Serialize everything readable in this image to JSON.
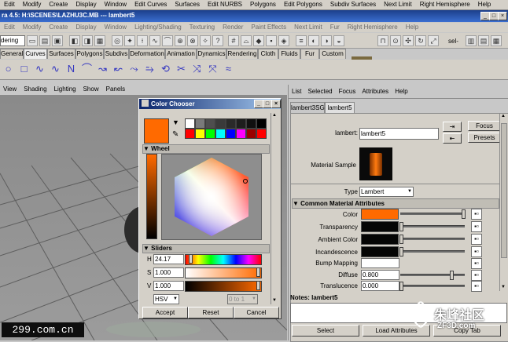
{
  "menubar": [
    "Edit",
    "Modify",
    "Create",
    "Display",
    "Window",
    "Edit Curves",
    "Surfaces",
    "Edit NURBS",
    "Polygons",
    "Edit Polygons",
    "Subdiv Surfaces",
    "Next Limit",
    "Right Hemisphere",
    "Help"
  ],
  "window_title": "ra 4.5: H:\\SCENES\\LAZHU3C.MB  ---  lambert5",
  "menubar2": [
    "Edit",
    "Modify",
    "Create",
    "Display",
    "Window",
    "Lighting/Shading",
    "Texturing",
    "Render",
    "Paint Effects",
    "Next Limit",
    "Fur",
    "Right Hemisphere",
    "Help"
  ],
  "mode_selector": "dering",
  "status_right": "sel-",
  "shelf_tabs": [
    "General",
    "Curves",
    "Surfaces",
    "Polygons",
    "Subdivs",
    "Deformation",
    "Animation",
    "Dynamics",
    "Rendering",
    "Cloth",
    "Fluids",
    "Fur",
    "Custom"
  ],
  "panel_menu": [
    "View",
    "Shading",
    "Lighting",
    "Show",
    "Panels"
  ],
  "color_chooser": {
    "title": "Color Chooser",
    "wheel_label": "Wheel",
    "sliders_label": "Sliders",
    "h_label": "H",
    "h_value": "24.17",
    "s_label": "S",
    "s_value": "1.000",
    "v_label": "V",
    "v_value": "1.000",
    "mode": "HSV",
    "range": "0 to 1",
    "accept": "Accept",
    "reset": "Reset",
    "cancel": "Cancel",
    "current_color": "#ff6a00",
    "swatches_row1": [
      "#ffffff",
      "#7a7a7a",
      "#4e4e4e",
      "#3a3a3a",
      "#2a2a2a",
      "#1e1e1e",
      "#101010",
      "#000000"
    ],
    "swatches_row2": [
      "#ff0000",
      "#ffff00",
      "#00ff00",
      "#00ffff",
      "#0000ff",
      "#ff00ff",
      "#9a0000",
      "#ff0000"
    ]
  },
  "attr_editor": {
    "menu": [
      "List",
      "Selected",
      "Focus",
      "Attributes",
      "Help"
    ],
    "tabs": [
      "lambert3SG",
      "lambert5"
    ],
    "lambert_label": "lambert:",
    "lambert_value": "lambert5",
    "focus": "Focus",
    "presets": "Presets",
    "material_sample": "Material Sample",
    "type_label": "Type",
    "type_value": "Lambert",
    "section": "Common Material Attributes",
    "attrs": [
      {
        "label": "Color",
        "color": "#ff6a00"
      },
      {
        "label": "Transparency",
        "color": "#050505"
      },
      {
        "label": "Ambient Color",
        "color": "#050505"
      },
      {
        "label": "Incandescence",
        "color": "#050505"
      }
    ],
    "bump_label": "Bump Mapping",
    "diffuse_label": "Diffuse",
    "diffuse_value": "0.800",
    "diffuse_level": 0.8,
    "translucence_label": "Translucence",
    "translucence_value": "0.000",
    "translucence_level": 0.0,
    "notes_label": "Notes: lambert5",
    "select": "Select",
    "load_attributes": "Load Attributes",
    "copy_tab": "Copy Tab"
  },
  "watermark_left": "299.com.cn",
  "watermark_right_cn": "朱峰社区",
  "watermark_right_en": "ZF3D.com"
}
